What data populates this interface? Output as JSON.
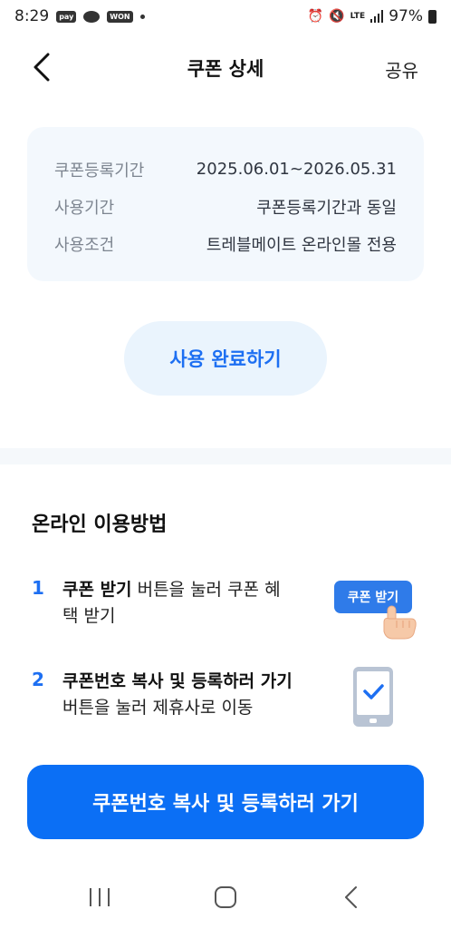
{
  "status_bar": {
    "time": "8:29",
    "pay_label": "pay",
    "won_label": "WON",
    "lte_label": "LTE",
    "battery": "97%"
  },
  "header": {
    "title": "쿠폰 상세",
    "share_label": "공유"
  },
  "info": {
    "rows": [
      {
        "label": "쿠폰등록기간",
        "value": "2025.06.01~2026.05.31"
      },
      {
        "label": "사용기간",
        "value": "쿠폰등록기간과 동일"
      },
      {
        "label": "사용조건",
        "value": "트레블메이트 온라인몰 전용"
      }
    ]
  },
  "use_complete_label": "사용 완료하기",
  "section_title": "온라인 이용방법",
  "steps": [
    {
      "num": "1",
      "bold": "쿠폰 받기",
      "rest": " 버튼을 눌러 쿠폰 혜택 받기"
    },
    {
      "num": "2",
      "bold": "쿠폰번호 복사 및 등록하러 가기",
      "rest": " 버튼을 눌러 제휴사로 이동"
    }
  ],
  "illustration_button_label": "쿠폰 받기",
  "cta_label": "쿠폰번호 복사 및 등록하러 가기",
  "colors": {
    "accent": "#0b6ff5",
    "card_bg": "#f3f8fd"
  }
}
